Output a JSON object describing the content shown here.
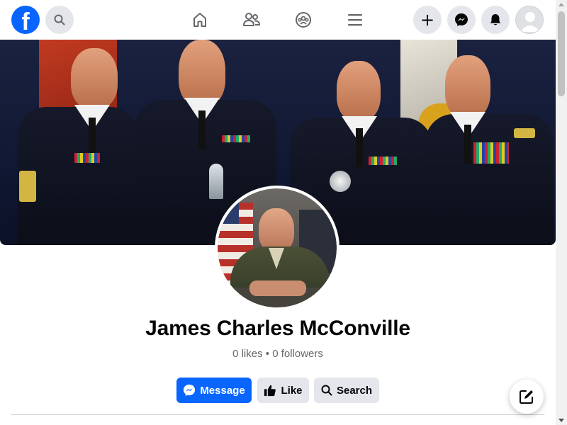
{
  "topbar": {
    "logo_letter": "f",
    "icons": {
      "search": "search-icon",
      "home": "home-icon",
      "friends": "friends-icon",
      "groups": "groups-icon",
      "menu": "menu-icon",
      "create": "plus-icon",
      "messenger": "messenger-icon",
      "notifications": "bell-icon",
      "account": "avatar"
    },
    "create_symbol": "+"
  },
  "profile": {
    "name": "James Charles McConville",
    "stats": "0 likes • 0 followers"
  },
  "actions": {
    "message_label": "Message",
    "like_label": "Like",
    "search_label": "Search"
  },
  "colors": {
    "brand": "#0866ff",
    "secondary_button": "#e4e6eb",
    "text_primary": "#050505",
    "text_secondary": "#65676b"
  }
}
